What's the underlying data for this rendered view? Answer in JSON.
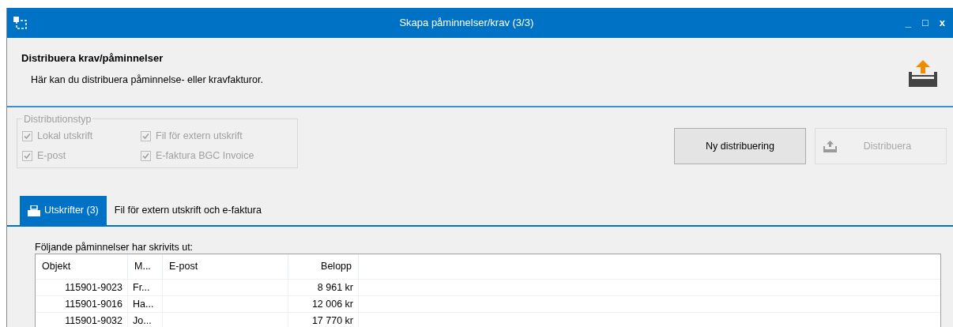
{
  "window": {
    "title": "Skapa påminnelser/krav (3/3)",
    "controls": [
      "_",
      "□",
      "x"
    ]
  },
  "header": {
    "title": "Distribuera krav/påminnelser",
    "subtitle": "Här kan du distribuera påminnelse- eller kravfakturor."
  },
  "distribution": {
    "legend": "Distributionstyp",
    "disabled": true,
    "options": [
      {
        "label": "Lokal utskrift",
        "checked": true
      },
      {
        "label": "Fil för extern utskrift",
        "checked": true
      },
      {
        "label": "E-post",
        "checked": true
      },
      {
        "label": "E-faktura BGC Invoice",
        "checked": true
      }
    ]
  },
  "buttons": [
    {
      "label": "Ny distribuering",
      "disabled": false,
      "icon": false
    },
    {
      "label": "Distribuera",
      "disabled": true,
      "icon": true
    }
  ],
  "tabs": [
    {
      "label": "Utskrifter (3)",
      "selected": true,
      "icon": true
    },
    {
      "label": "Fil för extern utskrift och e-faktura",
      "selected": false,
      "icon": false
    }
  ],
  "list_label": "Följande påminnelser har skrivits ut:",
  "table": {
    "columns": [
      "Objekt",
      "M...",
      "E-post",
      "Belopp"
    ],
    "rows": [
      [
        "115901-9023",
        "Fr...",
        "",
        "8 961 kr"
      ],
      [
        "115901-9016",
        "Ha...",
        "",
        "12 006 kr"
      ],
      [
        "115901-9032",
        "Jo...",
        "",
        "17 770 kr"
      ]
    ]
  }
}
